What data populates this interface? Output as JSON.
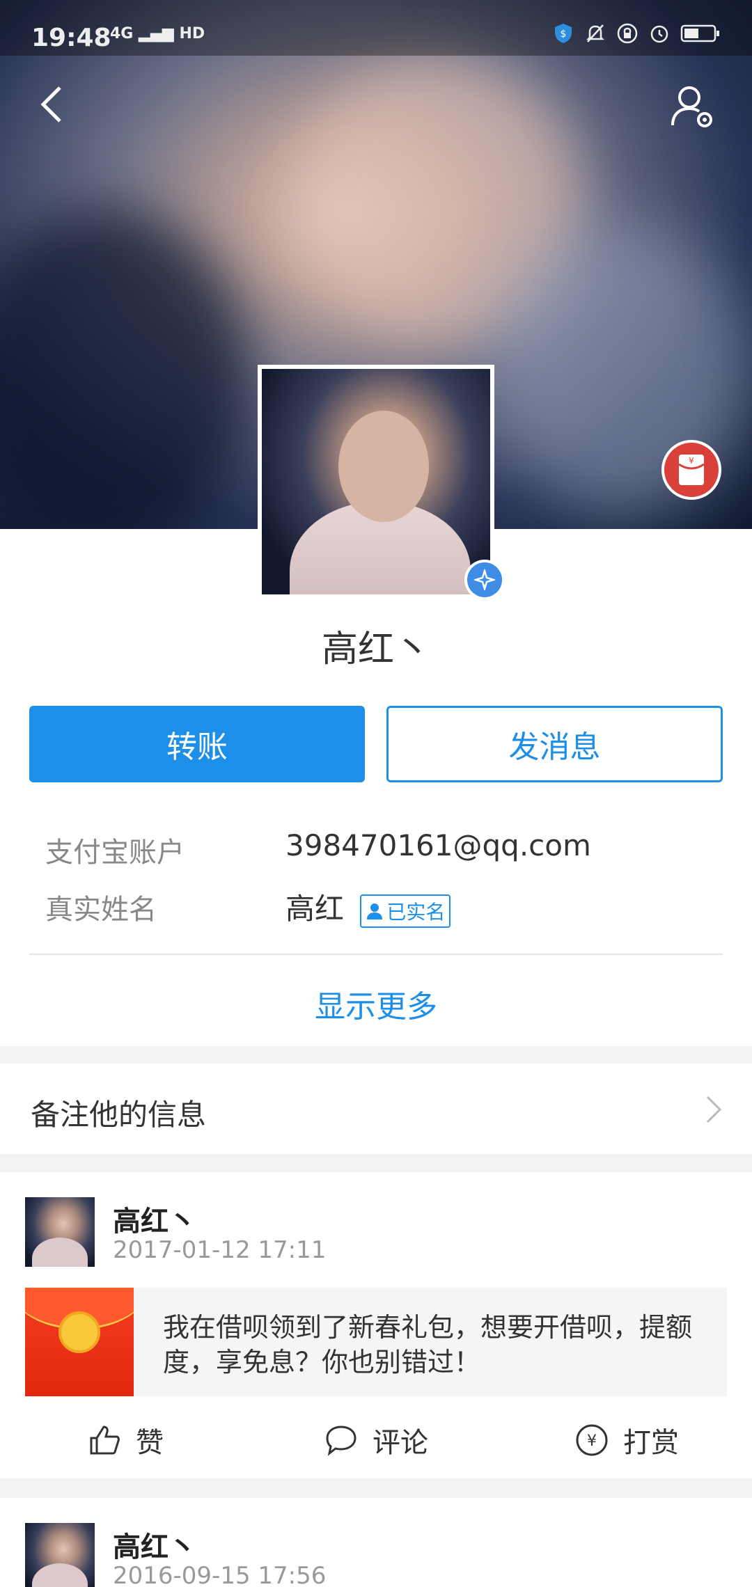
{
  "status_bar": {
    "time": "19:48",
    "network": "4G",
    "hd": "HD"
  },
  "profile": {
    "name": "高红丶",
    "verified_badge": "已实名"
  },
  "buttons": {
    "transfer": "转账",
    "message": "发消息"
  },
  "info": {
    "account_label": "支付宝账户",
    "account_value": "398470161@qq.com",
    "realname_label": "真实姓名",
    "realname_value": "高红"
  },
  "show_more": "显示更多",
  "remark": {
    "label": "备注他的信息"
  },
  "feed": [
    {
      "name": "高红丶",
      "time": "2017-01-12 17:11",
      "share_text": "我在借呗领到了新春礼包，想要开借呗，提额度，享免息？你也别错过！",
      "actions": {
        "like": "赞",
        "comment": "评论",
        "tip": "打赏"
      }
    },
    {
      "name": "高红丶",
      "time": "2016-09-15 17:56"
    }
  ],
  "colors": {
    "accent": "#1d8fe8",
    "red_packet": "#d9403a"
  }
}
